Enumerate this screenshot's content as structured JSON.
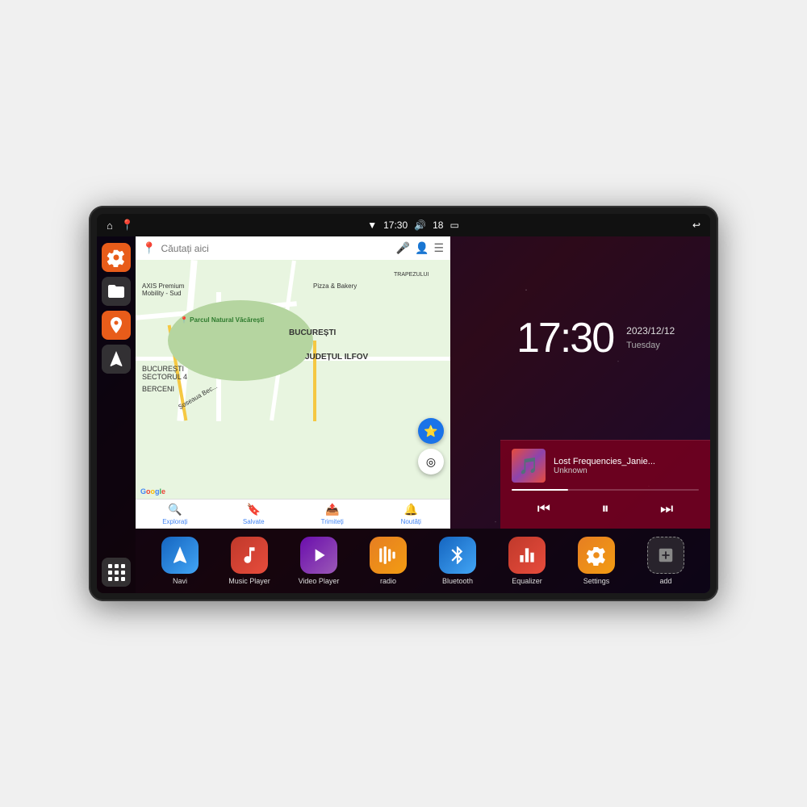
{
  "device": {
    "status_bar": {
      "left_icons": [
        "home",
        "map"
      ],
      "wifi_icon": "wifi",
      "time": "17:30",
      "volume_icon": "volume",
      "battery_level": "18",
      "battery_icon": "battery",
      "back_icon": "back"
    },
    "clock": {
      "time": "17:30",
      "date": "2023/12/12",
      "day": "Tuesday"
    },
    "music": {
      "title": "Lost Frequencies_Janie...",
      "artist": "Unknown",
      "progress": 30
    },
    "map": {
      "search_placeholder": "Căutați aici",
      "places": [
        "AXIS Premium Mobility - Sud",
        "Pizza & Bakery",
        "Parcul Natural Văcărești",
        "BUCUREȘTI SECTORUL 4",
        "BERCENI",
        "BUCUREȘTI",
        "JUDEȚUL ILFOV",
        "TRAPEZULUI"
      ],
      "footer_items": [
        {
          "icon": "🔍",
          "label": "Explorați"
        },
        {
          "icon": "🔖",
          "label": "Salvate"
        },
        {
          "icon": "📤",
          "label": "Trimiteți"
        },
        {
          "icon": "🔔",
          "label": "Noutăți"
        }
      ]
    },
    "sidebar": {
      "items": [
        {
          "icon": "settings",
          "color": "orange"
        },
        {
          "icon": "file",
          "color": "dark"
        },
        {
          "icon": "map",
          "color": "orange"
        },
        {
          "icon": "navigation",
          "color": "dark"
        }
      ],
      "bottom": {
        "icon": "grid"
      }
    },
    "apps": [
      {
        "id": "navi",
        "label": "Navi",
        "icon": "navigation",
        "color": "navi"
      },
      {
        "id": "music-player",
        "label": "Music Player",
        "icon": "music",
        "color": "music"
      },
      {
        "id": "video-player",
        "label": "Video Player",
        "icon": "video",
        "color": "video"
      },
      {
        "id": "radio",
        "label": "radio",
        "icon": "radio",
        "color": "radio"
      },
      {
        "id": "bluetooth",
        "label": "Bluetooth",
        "icon": "bluetooth",
        "color": "bluetooth"
      },
      {
        "id": "equalizer",
        "label": "Equalizer",
        "icon": "equalizer",
        "color": "eq"
      },
      {
        "id": "settings",
        "label": "Settings",
        "icon": "settings",
        "color": "settings"
      },
      {
        "id": "add",
        "label": "add",
        "icon": "plus",
        "color": "add"
      }
    ]
  }
}
